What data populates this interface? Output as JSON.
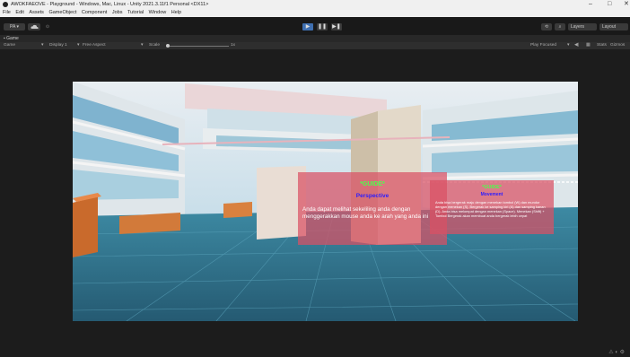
{
  "window": {
    "title": "AWOKFAEOVE - Playground - Windows, Mac, Linux - Unity 2021.3.11f1 Personal <DX11>",
    "controls": [
      "–",
      "□",
      "✕"
    ]
  },
  "menu": [
    "File",
    "Edit",
    "Assets",
    "GameObject",
    "Component",
    "Jobs",
    "Tutorial",
    "Window",
    "Help"
  ],
  "toolbar": {
    "account_label": "PA ▾",
    "layers_label": "Layers",
    "layout_label": "Layout"
  },
  "tab": {
    "label": "Game"
  },
  "game_toolbar": {
    "mode": "Game",
    "display": "Display 1",
    "aspect": "Free Aspect",
    "scale_label": "Scale",
    "scale_value": "1x",
    "play_focused": "Play Focused",
    "stats": "Stats",
    "gizmos": "Gizmos"
  },
  "guide_left": {
    "heading": "*GUIDE*",
    "title": "Perspective",
    "body": "Anda dapat melihat sekeliling anda dengan menggerakkan mouse anda ke arah yang anda ini"
  },
  "guide_right": {
    "heading": "*GUIDE*",
    "title": "Movement",
    "body": "Anda bisa bergerak maju dengan menekan tombol (W) dan mundur dengan menekan (S). Bergerak ke samping kiri (A) dan samping kanan (D). Anda bisa melompat dengan menekan (Space). Menekan (Shift) + Tombol Bergerak akan membuat anda bergerak lebih cepat"
  },
  "colors": {
    "panel": "#da5064",
    "guide_heading": "#4cff4c",
    "guide_title": "#2a1cff",
    "floor": "#2f6e86",
    "sky": "#c9e2f0"
  }
}
